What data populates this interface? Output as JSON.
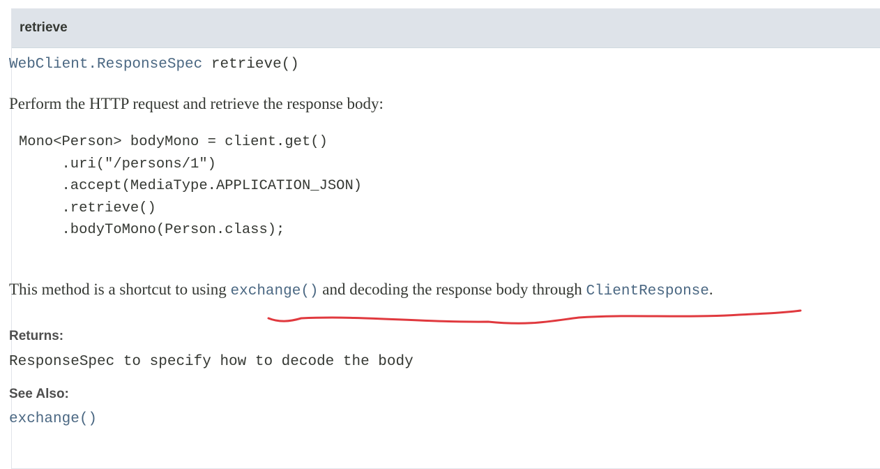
{
  "method": {
    "name": "retrieve",
    "signature": {
      "return_type": "WebClient.ResponseSpec",
      "method_call": "retrieve()"
    },
    "description": "Perform the HTTP request and retrieve the response body:",
    "code_example": [
      "Mono<Person> bodyMono = client.get()",
      "     .uri(\"/persons/1\")",
      "     .accept(MediaType.APPLICATION_JSON)",
      "     .retrieve()",
      "     .bodyToMono(Person.class);"
    ],
    "shortcut_text": {
      "part1": "This method is a shortcut to using ",
      "link1": "exchange()",
      "part2": " and decoding the response body through ",
      "link2": "ClientResponse",
      "part3": "."
    },
    "returns": {
      "label": "Returns:",
      "value": "ResponseSpec to specify how to decode the body"
    },
    "see_also": {
      "label": "See Also:",
      "link": "exchange()"
    }
  },
  "colors": {
    "header_bg": "#dee3e9",
    "link": "#4a6782",
    "text": "#353833",
    "annotation": "#e0393e"
  }
}
